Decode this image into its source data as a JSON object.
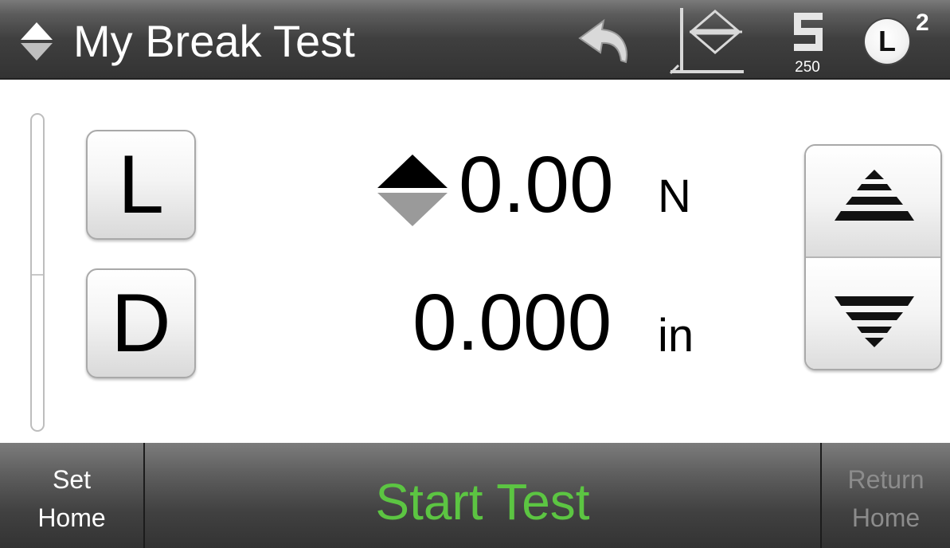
{
  "header": {
    "title": "My Break Test",
    "title_icon": "up-down-diamond-icon",
    "undo_icon": "undo-arrow-icon",
    "zero_icon": "zero-position-icon",
    "speed": {
      "digit": "5",
      "value": "250"
    },
    "load_cell": {
      "letter": "L",
      "superscript": "2"
    }
  },
  "left_buttons": {
    "load_label": "L",
    "displacement_label": "D"
  },
  "readouts": {
    "load": {
      "value": "0.00",
      "unit": "N",
      "direction_icon": "load-direction-icon"
    },
    "displacement": {
      "value": "0.000",
      "unit": "in"
    }
  },
  "jog": {
    "up_icon": "jog-up-icon",
    "down_icon": "jog-down-icon"
  },
  "footer": {
    "set_home": {
      "line1": "Set",
      "line2": "Home"
    },
    "start_test": "Start Test",
    "return_home": {
      "line1": "Return",
      "line2": "Home"
    }
  },
  "colors": {
    "header_bg": "#3f3f3f",
    "start_test": "#5cc542",
    "disabled_text": "#8c8c8c",
    "text_light": "#ffffff"
  }
}
